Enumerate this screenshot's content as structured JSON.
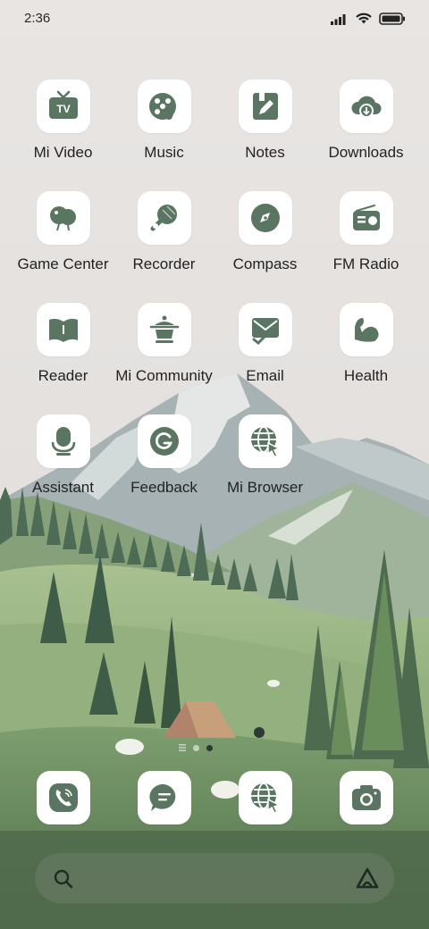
{
  "status_bar": {
    "time": "2:36"
  },
  "apps": [
    {
      "label": "Mi Video",
      "icon": "tv-icon"
    },
    {
      "label": "Music",
      "icon": "music-disc-icon"
    },
    {
      "label": "Notes",
      "icon": "notes-pencil-icon"
    },
    {
      "label": "Downloads",
      "icon": "cloud-download-icon"
    },
    {
      "label": "Game Center",
      "icon": "balloon-icon"
    },
    {
      "label": "Recorder",
      "icon": "microphone-icon"
    },
    {
      "label": "Compass",
      "icon": "compass-icon"
    },
    {
      "label": "FM Radio",
      "icon": "radio-icon"
    },
    {
      "label": "Reader",
      "icon": "book-icon"
    },
    {
      "label": "Mi Community",
      "icon": "pot-icon"
    },
    {
      "label": "Email",
      "icon": "envelope-icon"
    },
    {
      "label": "Health",
      "icon": "muscle-icon"
    },
    {
      "label": "Assistant",
      "icon": "assistant-mic-icon"
    },
    {
      "label": "Feedback",
      "icon": "feedback-g-icon"
    },
    {
      "label": "Mi Browser",
      "icon": "globe-cursor-icon"
    }
  ],
  "dock": [
    {
      "icon": "phone-icon"
    },
    {
      "icon": "message-icon"
    },
    {
      "icon": "browser-icon"
    },
    {
      "icon": "camera-icon"
    }
  ],
  "colors": {
    "icon": "#5b7563",
    "tile": "#ffffff"
  },
  "page_indicator": {
    "pages": 2,
    "current": 2
  }
}
